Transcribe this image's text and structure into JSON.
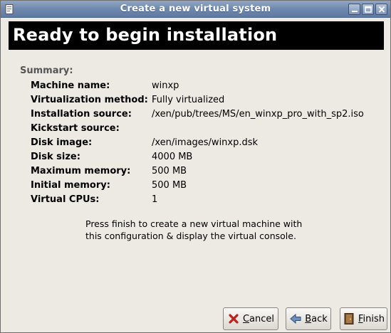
{
  "window": {
    "title": "Create a new virtual system"
  },
  "banner": {
    "heading": "Ready to begin installation"
  },
  "summary": {
    "label": "Summary:",
    "rows": [
      {
        "key": "Machine name:",
        "value": "winxp"
      },
      {
        "key": "Virtualization method:",
        "value": "Fully virtualized"
      },
      {
        "key": "Installation source:",
        "value": "/xen/pub/trees/MS/en_winxp_pro_with_sp2.iso"
      },
      {
        "key": "Kickstart source:",
        "value": ""
      },
      {
        "key": "Disk image:",
        "value": "/xen/images/winxp.dsk"
      },
      {
        "key": "Disk size:",
        "value": "4000 MB"
      },
      {
        "key": "Maximum memory:",
        "value": "500 MB"
      },
      {
        "key": "Initial memory:",
        "value": "500 MB"
      },
      {
        "key": "Virtual CPUs:",
        "value": "1"
      }
    ]
  },
  "note": {
    "line1": "Press finish to create a new virtual machine with",
    "line2": "this configuration & display the virtual console."
  },
  "buttons": {
    "cancel": {
      "mnemonic": "C",
      "rest": "ancel"
    },
    "back": {
      "mnemonic": "B",
      "rest": "ack"
    },
    "finish": {
      "mnemonic": "F",
      "rest": "inish"
    }
  },
  "icons": {
    "app": "document-icon",
    "minimize": "minimize-icon",
    "maximize": "maximize-icon",
    "close": "close-icon",
    "cancel": "cancel-x-icon",
    "back": "back-arrow-icon",
    "finish": "finish-door-icon"
  },
  "colors": {
    "titlebar": "#6e88ae",
    "window_bg": "#ede9e3",
    "banner_bg": "#000000",
    "banner_text": "#ffffff",
    "cancel_icon": "#c0201a"
  }
}
